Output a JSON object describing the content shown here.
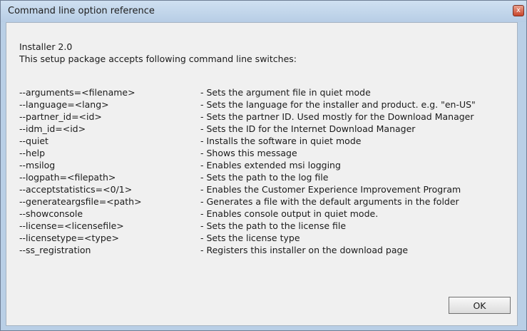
{
  "window": {
    "title": "Command  line option reference",
    "close_glyph": "x"
  },
  "content": {
    "line1": "Installer 2.0",
    "line2": "This setup package accepts following command line switches:",
    "options": [
      {
        "switch": "--arguments=<filename>",
        "desc": "- Sets the argument file in quiet mode"
      },
      {
        "switch": "--language=<lang>",
        "desc": "- Sets the language for the installer and product. e.g. \"en-US\""
      },
      {
        "switch": "--partner_id=<id>",
        "desc": "- Sets the partner ID. Used mostly for the Download Manager"
      },
      {
        "switch": "--idm_id=<id>",
        "desc": "- Sets the ID for the Internet Download Manager"
      },
      {
        "switch": "--quiet",
        "desc": "- Installs the software in quiet mode"
      },
      {
        "switch": "--help",
        "desc": "- Shows this message"
      },
      {
        "switch": "--msilog",
        "desc": "- Enables extended msi logging"
      },
      {
        "switch": "--logpath=<filepath>",
        "desc": "- Sets the path to the log file"
      },
      {
        "switch": "--acceptstatistics=<0/1>",
        "desc": "- Enables the Customer Experience Improvement Program"
      },
      {
        "switch": "--generateargsfile=<path>",
        "desc": "- Generates a file with the default arguments in the folder"
      },
      {
        "switch": "--showconsole",
        "desc": "- Enables console output in quiet mode."
      },
      {
        "switch": "--license=<licensefile>",
        "desc": "- Sets the path to the license file"
      },
      {
        "switch": "--licensetype=<type>",
        "desc": "- Sets the license type"
      },
      {
        "switch": "--ss_registration",
        "desc": "- Registers this installer on the download page"
      }
    ]
  },
  "buttons": {
    "ok_label": "OK"
  }
}
